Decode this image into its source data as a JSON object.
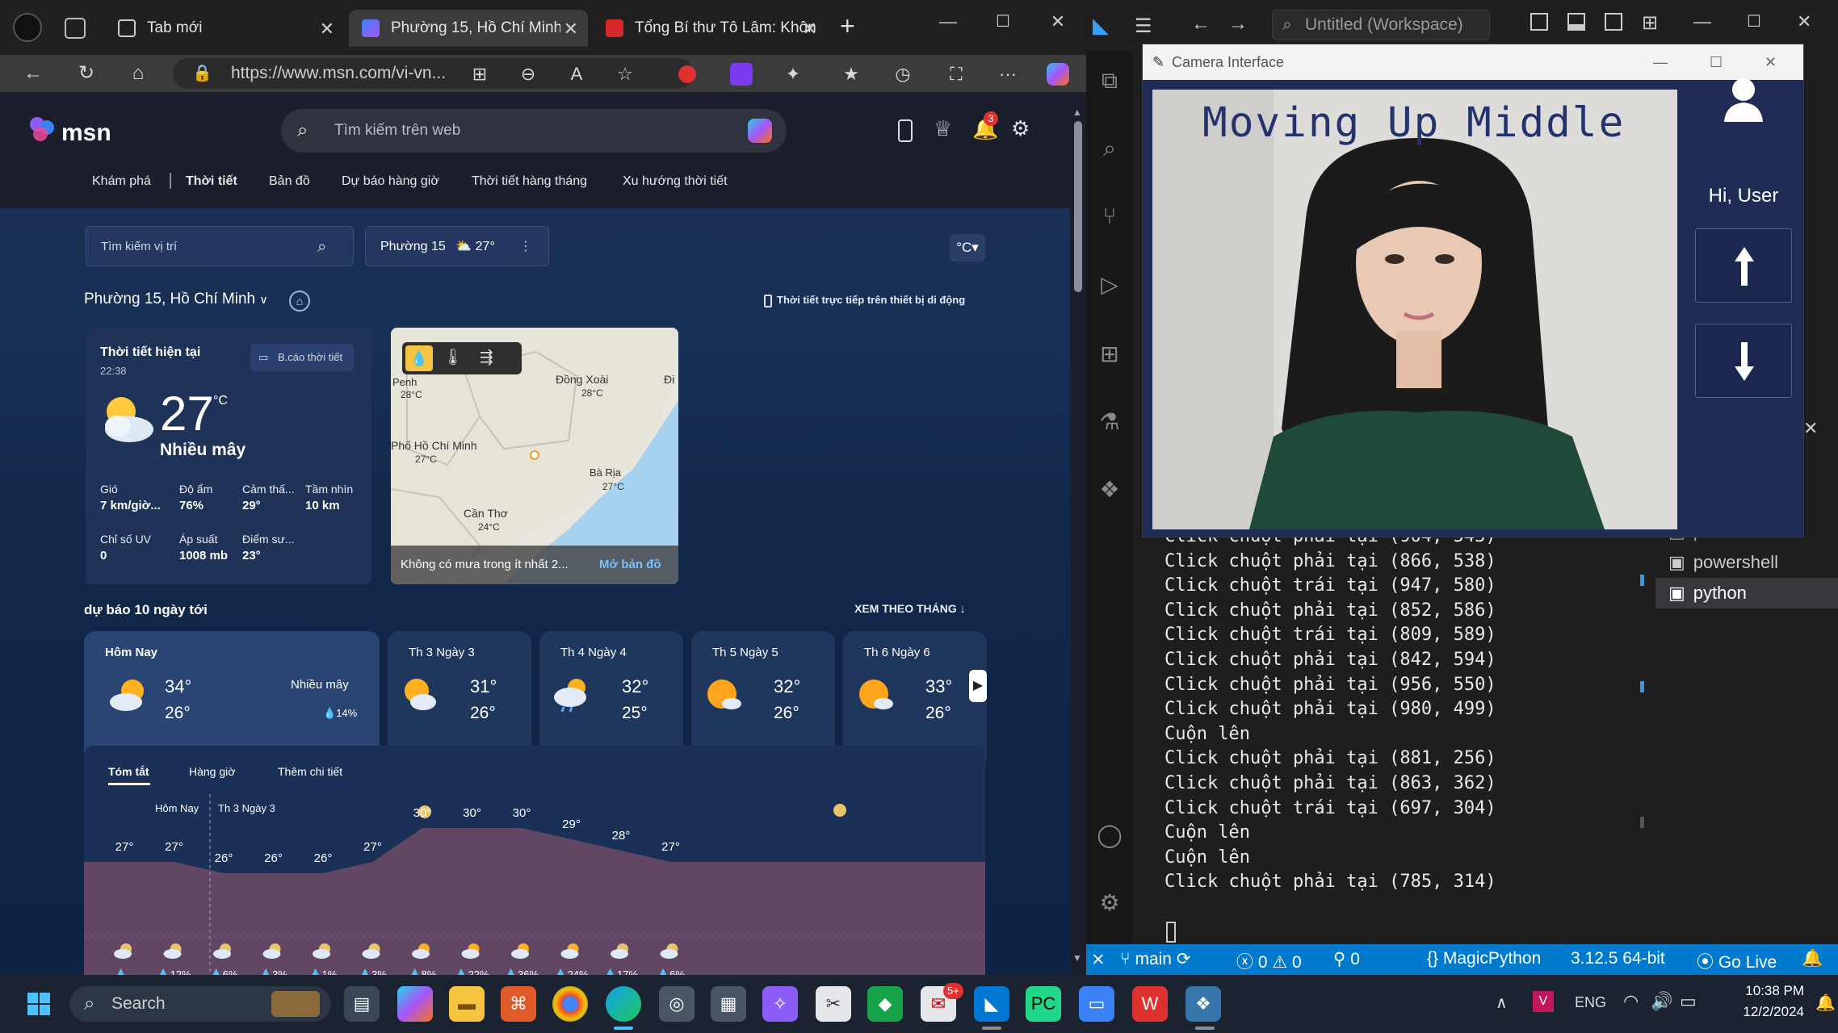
{
  "browser": {
    "tabs": [
      {
        "title": "Tab mới"
      },
      {
        "title": "Phường 15, Hồ Chí Minh l"
      },
      {
        "title": "Tổng Bí thư Tô Lâm: Khôn"
      }
    ],
    "url": "https://www.msn.com/vi-vn...",
    "msn": {
      "logo": "msn",
      "search_placeholder": "Tìm kiếm trên web",
      "notif_count": "3",
      "nav": [
        "Khám phá",
        "Thời tiết",
        "Bản đồ",
        "Dự báo hàng giờ",
        "Thời tiết hàng tháng",
        "Xu hướng thời tiết"
      ],
      "location_search_placeholder": "Tìm kiếm vị trí",
      "location_chip": {
        "name": "Phường 15",
        "temp": "27°"
      },
      "unit": "°C",
      "location_title": "Phường 15, Hồ Chí Minh",
      "mobile_link": "Thời tiết trực tiếp trên thiết bị di động",
      "current": {
        "heading": "Thời tiết hiện tại",
        "time": "22:38",
        "report_btn": "B.cáo thời tiết",
        "temp": "27",
        "unit": "°C",
        "condition": "Nhiều mây",
        "details": [
          {
            "label": "Gió",
            "value": "7 km/giờ..."
          },
          {
            "label": "Độ ẩm",
            "value": "76%"
          },
          {
            "label": "Cảm thấ...",
            "value": "29°"
          },
          {
            "label": "Tầm nhìn",
            "value": "10 km"
          },
          {
            "label": "Chỉ số UV",
            "value": "0"
          },
          {
            "label": "Áp suất",
            "value": "1008 mb"
          },
          {
            "label": "Điểm sư...",
            "value": "23°"
          }
        ]
      },
      "map": {
        "labels": [
          {
            "name": "Phnom Penh",
            "short": "Penh",
            "temp": "28°C"
          },
          {
            "name": "Đồng Xoài",
            "temp": "28°C"
          },
          {
            "name": "Đi",
            "temp": ""
          },
          {
            "name": "Phố Hồ Chí Minh",
            "temp": "27°C"
          },
          {
            "name": "Bà Rịa",
            "temp": "27°C"
          },
          {
            "name": "Cần Thơ",
            "temp": "24°C"
          }
        ],
        "footer": "Không có mưa trong ít nhất 2...",
        "open_map": "Mở bản đồ"
      },
      "forecast_title": "dự báo 10 ngày tới",
      "view_month": "XEM THEO THÁNG",
      "days": [
        {
          "label": "Hôm Nay",
          "high": "34°",
          "low": "26°",
          "cond": "Nhiều mây",
          "rain": "14%"
        },
        {
          "label": "Th 3 Ngày 3",
          "high": "31°",
          "low": "26°"
        },
        {
          "label": "Th 4 Ngày 4",
          "high": "32°",
          "low": "25°"
        },
        {
          "label": "Th 5 Ngày 5",
          "high": "32°",
          "low": "26°"
        },
        {
          "label": "Th 6 Ngày 6",
          "high": "33°",
          "low": "26°"
        }
      ],
      "hourly_tabs": [
        "Tóm tắt",
        "Hàng giờ",
        "Thêm chi tiết"
      ],
      "hourly_days": [
        "Hôm Nay",
        "Th 3 Ngày 3"
      ],
      "hourly": [
        {
          "temp": 27,
          "rain": "--"
        },
        {
          "temp": 27,
          "rain": "12%"
        },
        {
          "temp": 26,
          "rain": "6%"
        },
        {
          "temp": 26,
          "rain": "3%"
        },
        {
          "temp": 26,
          "rain": "1%"
        },
        {
          "temp": 27,
          "rain": "3%"
        },
        {
          "temp": 30,
          "rain": "8%"
        },
        {
          "temp": 30,
          "rain": "22%"
        },
        {
          "temp": 30,
          "rain": "36%"
        },
        {
          "temp": 29,
          "rain": "24%"
        },
        {
          "temp": 28,
          "rain": "17%"
        },
        {
          "temp": 27,
          "rain": "6%"
        }
      ]
    }
  },
  "vscode": {
    "search": "Untitled (Workspace)",
    "terminal_lines": [
      "Click chuột phải tại (904, 543)",
      "Click chuột phải tại (866, 538)",
      "Click chuột trái tại (947, 580)",
      "Click chuột phải tại (852, 586)",
      "Click chuột trái tại (809, 589)",
      "Click chuột phải tại (842, 594)",
      "Click chuột phải tại (956, 550)",
      "Click chuột phải tại (980, 499)",
      "Cuộn lên",
      "Click chuột phải tại (881, 256)",
      "Click chuột phải tại (863, 362)",
      "Click chuột trái tại (697, 304)",
      "Cuộn lên",
      "Cuộn lên",
      "Click chuột phải tại (785, 314)"
    ],
    "terminals": [
      "powershell",
      "powershell",
      "python"
    ],
    "status": {
      "branch": "main",
      "errors": "0",
      "warnings": "0",
      "ports": "0",
      "lang": "MagicPython",
      "python": "3.12.5 64-bit",
      "golive": "Go Live"
    }
  },
  "camera": {
    "title": "Camera Interface",
    "overlay": "Moving Up Middle",
    "greeting": "Hi, User"
  },
  "taskbar": {
    "search": "Search",
    "lang": "ENG",
    "time": "10:38 PM",
    "date": "12/2/2024",
    "badge": "5+"
  }
}
